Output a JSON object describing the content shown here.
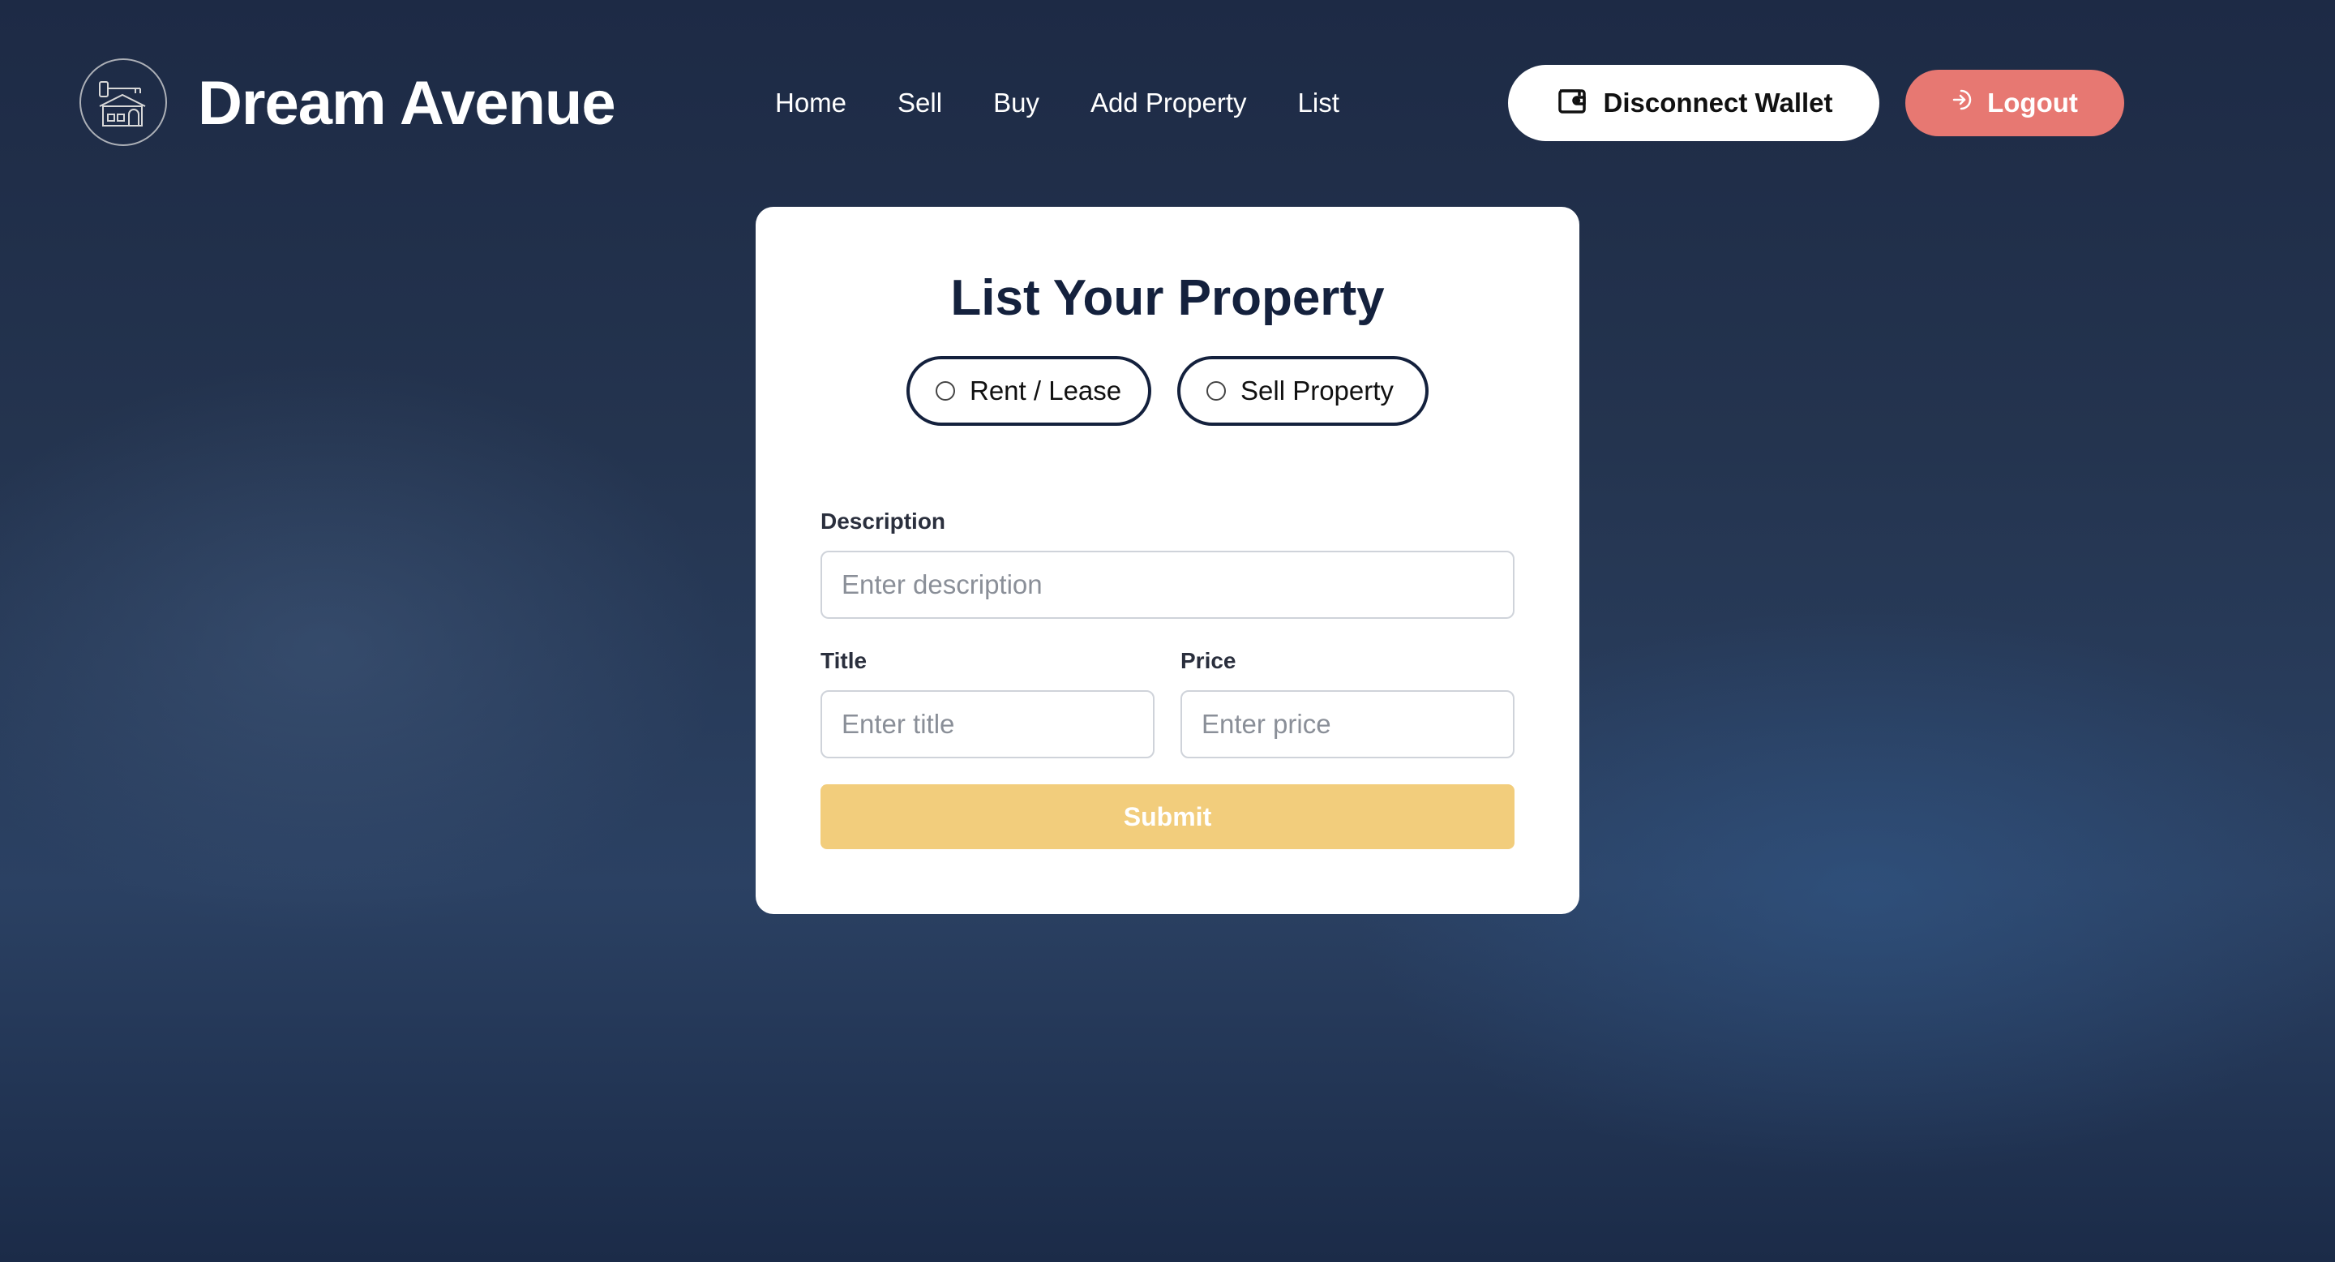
{
  "header": {
    "brand": "Dream Avenue",
    "logo_icon": "house-key-icon",
    "nav": [
      {
        "label": "Home"
      },
      {
        "label": "Sell"
      },
      {
        "label": "Buy"
      },
      {
        "label": "Add Property"
      },
      {
        "label": "List"
      }
    ],
    "wallet_button": {
      "label": "Disconnect Wallet",
      "icon": "wallet-icon"
    },
    "logout_button": {
      "label": "Logout",
      "icon": "logout-icon",
      "color": "#e77872"
    }
  },
  "form": {
    "title": "List Your Property",
    "listing_type": {
      "options": [
        {
          "label": "Rent / Lease",
          "selected": false
        },
        {
          "label": "Sell Property",
          "selected": false
        }
      ]
    },
    "description": {
      "label": "Description",
      "placeholder": "Enter description",
      "value": ""
    },
    "title_field": {
      "label": "Title",
      "placeholder": "Enter title",
      "value": ""
    },
    "price": {
      "label": "Price",
      "placeholder": "Enter price",
      "value": ""
    },
    "submit_label": "Submit",
    "submit_color": "#f2cd7c",
    "title_color": "#14213d"
  }
}
